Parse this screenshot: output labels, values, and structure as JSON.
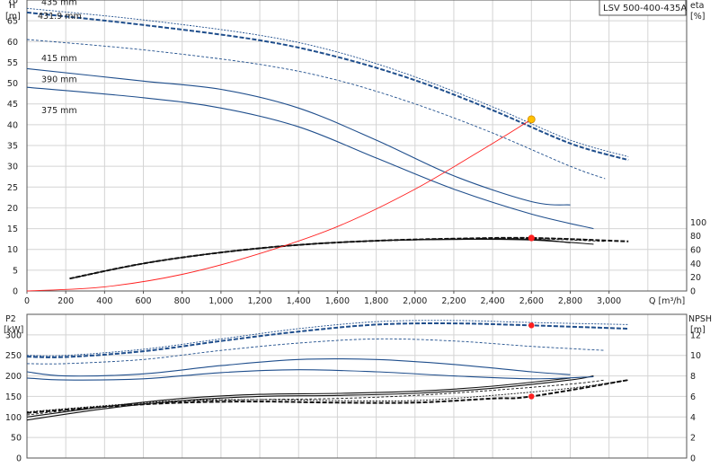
{
  "chart_data": [
    {
      "type": "line",
      "title": "LSV 500-400-435A",
      "x_axis_label": "Q [m³/h]",
      "y_left_label": "H",
      "y_left_unit": "[m]",
      "y_right_label": "eta",
      "y_right_unit": "[%]",
      "xlim": [
        0,
        3400
      ],
      "x_ticks": [
        0,
        200,
        400,
        600,
        800,
        1000,
        1200,
        1400,
        1600,
        1800,
        2000,
        2200,
        2400,
        2600,
        2800,
        3000
      ],
      "x_tick_labels": [
        "0",
        "200",
        "400",
        "600",
        "800",
        "1,000",
        "1,200",
        "1,400",
        "1,600",
        "1,800",
        "2,000",
        "2,200",
        "2,400",
        "2,600",
        "2,800",
        "3,000"
      ],
      "ylim_left": [
        0,
        70
      ],
      "y_left_ticks": [
        0,
        5,
        10,
        15,
        20,
        25,
        30,
        35,
        40,
        45,
        50,
        55,
        60,
        65,
        70
      ],
      "y_right_ticks": [
        0,
        20,
        40,
        60,
        80,
        100
      ],
      "grid": true,
      "head_curves": [
        {
          "name": "435 mm",
          "style": "dotted-thin",
          "x": [
            0,
            600,
            1200,
            1600,
            2000,
            2400,
            2800,
            3100
          ],
          "y": [
            68,
            65.2,
            61.5,
            57.5,
            51.5,
            44.3,
            36.3,
            32.3
          ]
        },
        {
          "name": "431.9 mm",
          "style": "dashed-bold",
          "x": [
            0,
            600,
            1200,
            1600,
            2000,
            2400,
            2800,
            3100
          ],
          "y": [
            67,
            64,
            60.3,
            56.3,
            50.7,
            43.5,
            35.5,
            31.5
          ]
        },
        {
          "name": "415 mm",
          "style": "dashed-thin",
          "x": [
            0,
            600,
            1200,
            1600,
            2000,
            2400,
            2800,
            2980
          ],
          "y": [
            60.5,
            58,
            54.5,
            50.7,
            45,
            38,
            30,
            27
          ]
        },
        {
          "name": "390 mm",
          "style": "solid",
          "x": [
            0,
            600,
            1000,
            1400,
            1800,
            2200,
            2600,
            2800
          ],
          "y": [
            53.5,
            50.5,
            48.5,
            44,
            36.3,
            27.7,
            21.5,
            20.7
          ]
        },
        {
          "name": "375 mm",
          "style": "solid",
          "x": [
            0,
            600,
            1000,
            1400,
            1800,
            2200,
            2600,
            2920
          ],
          "y": [
            49,
            46.5,
            44,
            39.5,
            32,
            24.5,
            18.5,
            15
          ]
        }
      ],
      "efficiency_curves": [
        {
          "style": "dotted-thin",
          "x": [
            220,
            600,
            1000,
            1400,
            1800,
            2200,
            2600,
            2900
          ],
          "y": [
            18,
            40,
            56,
            67,
            73,
            76,
            77,
            75
          ]
        },
        {
          "style": "dashed-bold",
          "x": [
            220,
            600,
            1000,
            1400,
            1800,
            2200,
            2600,
            3100
          ],
          "y": [
            18,
            40,
            56,
            67,
            73,
            76,
            77,
            72
          ]
        },
        {
          "style": "dashed-thin",
          "x": [
            220,
            600,
            1000,
            1400,
            1800,
            2200,
            2600,
            2980
          ],
          "y": [
            18,
            40,
            56,
            67,
            73,
            76,
            76,
            72
          ]
        },
        {
          "style": "solid",
          "x": [
            220,
            600,
            1000,
            1400,
            1800,
            2200,
            2600,
            2800
          ],
          "y": [
            18,
            40,
            56,
            67,
            73,
            75,
            75,
            70
          ]
        },
        {
          "style": "solid",
          "x": [
            220,
            600,
            1000,
            1400,
            1800,
            2200,
            2600,
            2920
          ],
          "y": [
            18,
            40,
            56,
            67,
            73,
            75,
            74,
            68
          ]
        }
      ],
      "system_curve": {
        "color": "#ff2020",
        "x": [
          0,
          400,
          800,
          1200,
          1600,
          2000,
          2400,
          2600
        ],
        "y": [
          0,
          1,
          4,
          9,
          15.5,
          24.5,
          35.5,
          41.3
        ]
      },
      "duty_points": [
        {
          "x": 2600,
          "y": 41.3,
          "axis": "left",
          "color": "#ffc000"
        },
        {
          "x": 2600,
          "y": 77,
          "axis": "right",
          "color": "#ff2020"
        }
      ]
    },
    {
      "type": "line",
      "x_axis_label": "Q [m³/h]",
      "y_left_label": "P2",
      "y_left_unit": "[kW]",
      "y_right_label": "NPSH",
      "y_right_unit": "[m]",
      "xlim": [
        0,
        3400
      ],
      "ylim_left": [
        0,
        350
      ],
      "y_left_ticks": [
        0,
        50,
        100,
        150,
        200,
        250,
        300,
        350
      ],
      "y_left_tick_labels": [
        "0",
        "50",
        "100",
        "150",
        "200",
        "250",
        "300",
        ""
      ],
      "y_right_ticks": [
        0,
        2,
        4,
        6,
        8,
        10,
        12,
        14
      ],
      "y_right_tick_labels": [
        "0",
        "2",
        "4",
        "6",
        "8",
        "10",
        "12",
        ""
      ],
      "grid": true,
      "power_curves": [
        {
          "style": "dotted-thin",
          "x": [
            0,
            200,
            600,
            1000,
            1400,
            1800,
            2200,
            2600,
            3100
          ],
          "y": [
            250,
            250,
            265,
            290,
            315,
            332,
            335,
            330,
            325
          ]
        },
        {
          "style": "dashed-bold",
          "x": [
            0,
            200,
            600,
            1000,
            1400,
            1800,
            2200,
            2600,
            3100
          ],
          "y": [
            247,
            246,
            260,
            285,
            308,
            325,
            328,
            323,
            315
          ]
        },
        {
          "style": "dashed-thin",
          "x": [
            0,
            200,
            600,
            1000,
            1400,
            1800,
            2200,
            2600,
            2980
          ],
          "y": [
            230,
            230,
            240,
            262,
            280,
            290,
            285,
            272,
            262
          ]
        },
        {
          "style": "solid",
          "x": [
            0,
            200,
            600,
            1000,
            1400,
            1800,
            2200,
            2600,
            2800
          ],
          "y": [
            210,
            200,
            205,
            225,
            240,
            240,
            228,
            210,
            203
          ]
        },
        {
          "style": "solid",
          "x": [
            0,
            200,
            600,
            1000,
            1400,
            1800,
            2200,
            2600,
            2920
          ],
          "y": [
            195,
            190,
            193,
            208,
            215,
            210,
            200,
            193,
            198
          ]
        }
      ],
      "npsh_curves": [
        {
          "style": "dotted-thin",
          "x": [
            0,
            400,
            800,
            1200,
            1600,
            2000,
            2400,
            2800,
            3100
          ],
          "y": [
            4.5,
            5.1,
            5.6,
            5.7,
            5.6,
            5.6,
            6.1,
            6.8,
            7.6
          ]
        },
        {
          "style": "dashed-bold",
          "x": [
            0,
            400,
            800,
            1200,
            1600,
            2000,
            2400,
            2600,
            3100
          ],
          "y": [
            4.4,
            5.0,
            5.4,
            5.5,
            5.4,
            5.4,
            5.8,
            6.0,
            7.6
          ]
        },
        {
          "style": "dashed-thin",
          "x": [
            0,
            400,
            800,
            1200,
            1600,
            2000,
            2400,
            2800,
            2980
          ],
          "y": [
            4.2,
            5.0,
            5.5,
            5.7,
            5.8,
            6.1,
            6.6,
            7.2,
            7.6
          ]
        },
        {
          "style": "solid",
          "x": [
            0,
            400,
            800,
            1200,
            1600,
            2000,
            2400,
            2800
          ],
          "y": [
            4.0,
            5.0,
            5.8,
            6.2,
            6.3,
            6.5,
            7.0,
            7.8
          ]
        },
        {
          "style": "solid",
          "x": [
            0,
            400,
            800,
            1200,
            1600,
            2000,
            2400,
            2800,
            2920
          ],
          "y": [
            3.7,
            4.8,
            5.6,
            6.0,
            6.1,
            6.3,
            6.8,
            7.6,
            8.0
          ]
        }
      ],
      "duty_points": [
        {
          "x": 2600,
          "y": 323,
          "axis": "left",
          "color": "#ff2020"
        },
        {
          "x": 2600,
          "y": 6.0,
          "axis": "right",
          "color": "#ff2020"
        }
      ]
    }
  ]
}
